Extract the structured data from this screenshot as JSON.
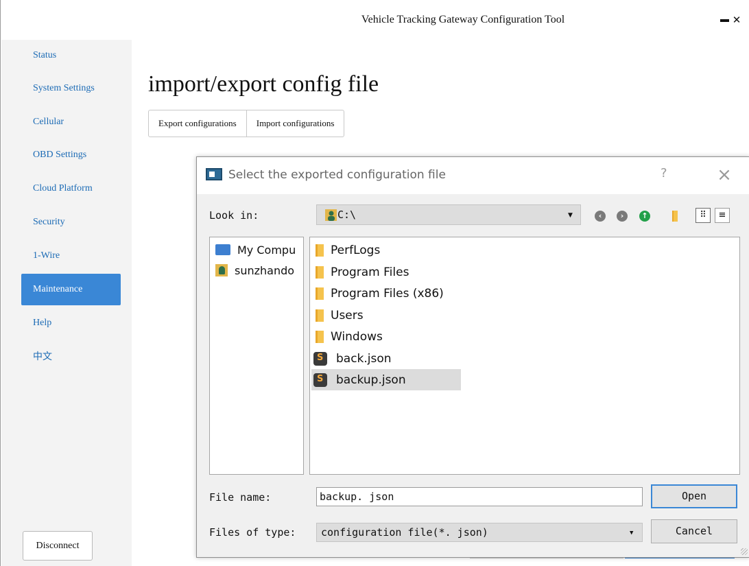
{
  "app": {
    "title": "Vehicle Tracking Gateway Configuration Tool",
    "minimize_icon": "minimize-icon",
    "close_icon": "close-icon"
  },
  "sidebar": {
    "items": [
      {
        "label": "Status",
        "active": false
      },
      {
        "label": "System Settings",
        "active": false
      },
      {
        "label": "Cellular",
        "active": false
      },
      {
        "label": "OBD Settings",
        "active": false
      },
      {
        "label": "Cloud Platform",
        "active": false
      },
      {
        "label": "Security",
        "active": false
      },
      {
        "label": "1-Wire",
        "active": false
      },
      {
        "label": "Maintenance",
        "active": true
      },
      {
        "label": "Help",
        "active": false
      },
      {
        "label": "中文",
        "active": false
      }
    ],
    "disconnect_label": "Disconnect"
  },
  "main": {
    "title": "import/export config file",
    "buttons": [
      "Export configurations",
      "Import configurations"
    ]
  },
  "dialog": {
    "title": "Select the exported configuration file",
    "help_glyph": "?",
    "close_glyph": "×",
    "look_in_label": "Look in:",
    "look_in_value": "C:\\",
    "toolbar_icons": [
      "back-icon",
      "forward-icon",
      "parent-directory-icon",
      "new-folder-icon",
      "list-view-icon",
      "detail-view-icon"
    ],
    "places": [
      {
        "label": "My Compu",
        "icon": "computer-icon"
      },
      {
        "label": "sunzhando",
        "icon": "user-folder-icon"
      }
    ],
    "files": [
      {
        "name": "PerfLogs",
        "icon": "folder-icon",
        "selected": false
      },
      {
        "name": "Program Files",
        "icon": "folder-icon",
        "selected": false
      },
      {
        "name": "Program Files (x86)",
        "icon": "folder-icon",
        "selected": false
      },
      {
        "name": "Users",
        "icon": "folder-icon",
        "selected": false
      },
      {
        "name": "Windows",
        "icon": "folder-icon",
        "selected": false
      },
      {
        "name": "back.json",
        "icon": "json-file-icon",
        "selected": false
      },
      {
        "name": "backup.json",
        "icon": "json-file-icon",
        "selected": true
      }
    ],
    "file_name_label": "File name:",
    "file_name_value": "backup. json",
    "file_type_label": "Files of type:",
    "file_type_value": "configuration file(*. json)",
    "open_label": "Open",
    "cancel_label": "Cancel"
  },
  "colors": {
    "accent": "#3a87d6",
    "nav_text": "#1c6bb5",
    "sidebar_bg": "#f3f3f3",
    "dialog_bg": "#f0f0f0",
    "selection_bg": "#dcdcdc",
    "folder": "#f5c34d"
  }
}
